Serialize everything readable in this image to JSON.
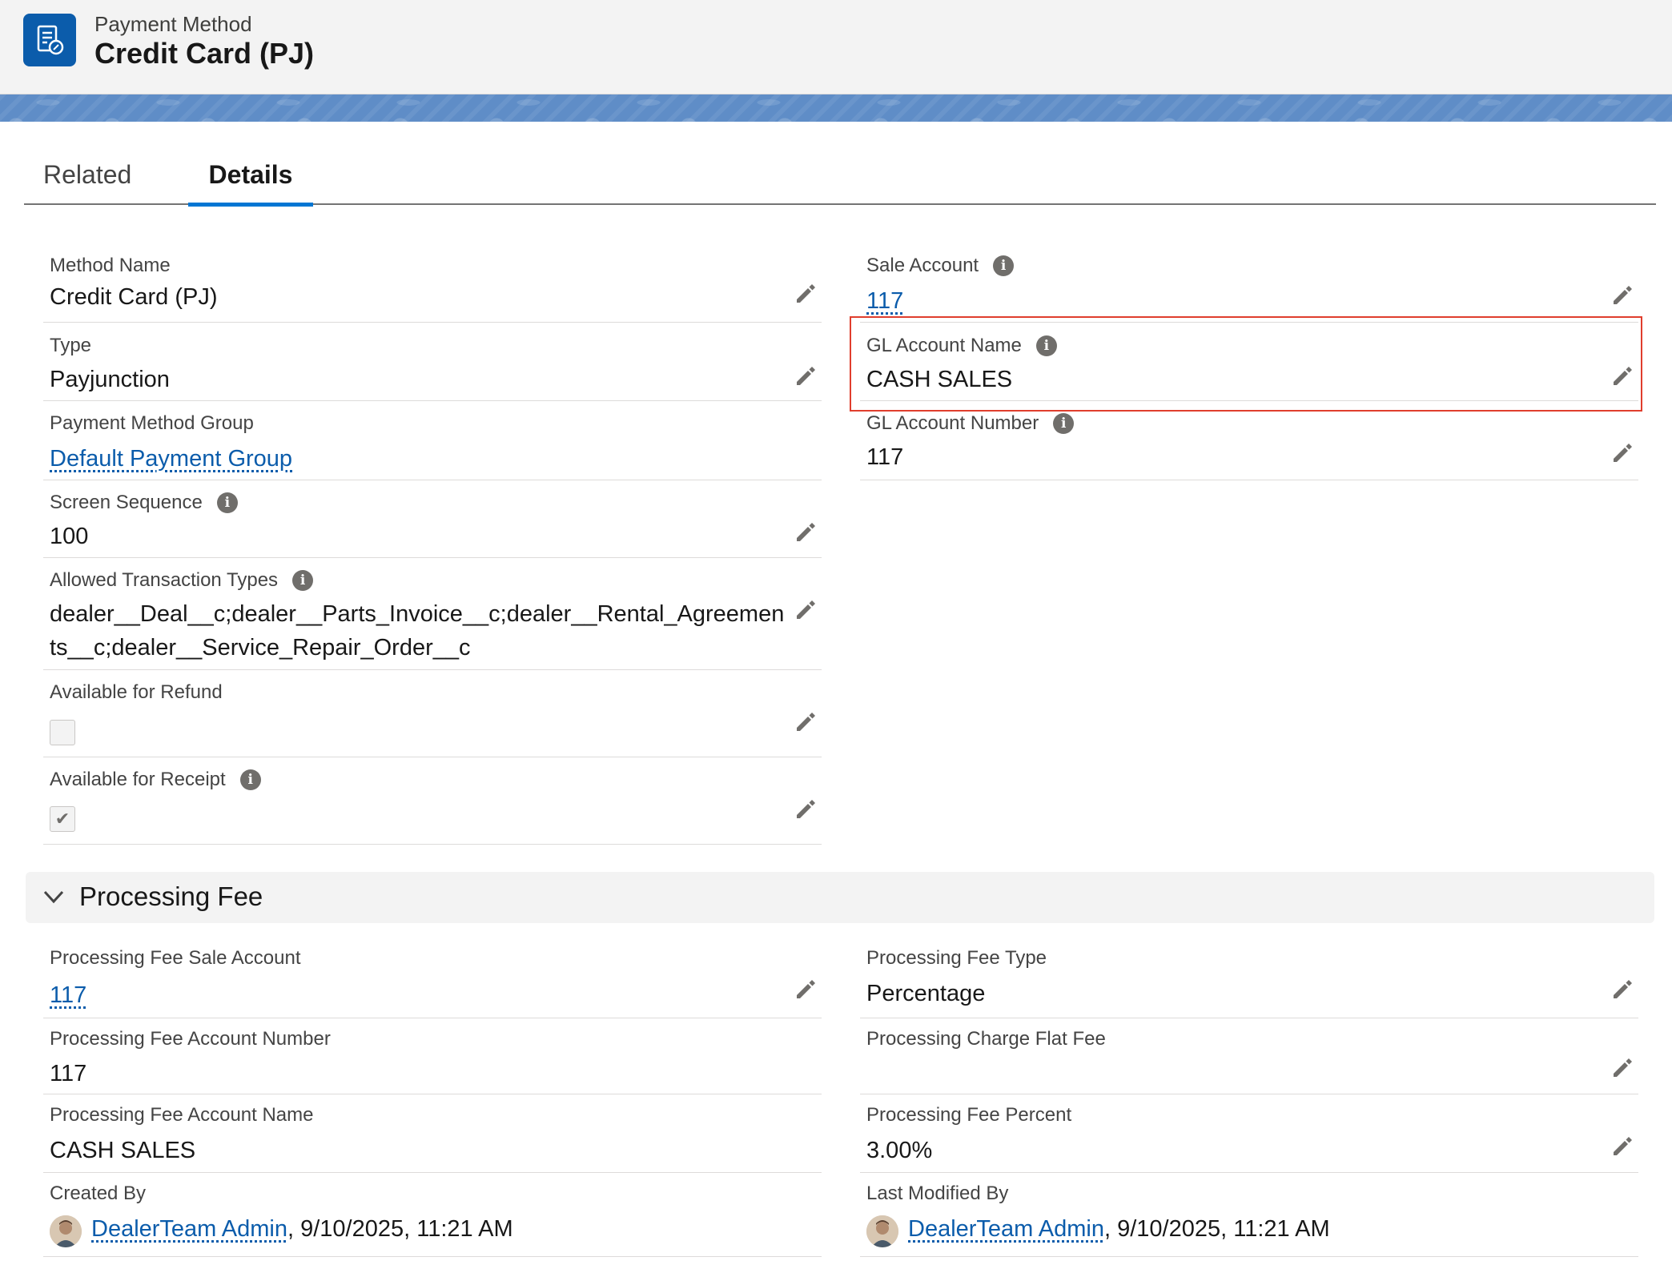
{
  "header": {
    "object_type": "Payment Method",
    "record_title": "Credit Card (PJ)"
  },
  "tabs": [
    {
      "label": "Related",
      "active": false
    },
    {
      "label": "Details",
      "active": true
    }
  ],
  "details": {
    "method_name": {
      "label": "Method Name",
      "value": "Credit Card (PJ)"
    },
    "type": {
      "label": "Type",
      "value": "Payjunction"
    },
    "payment_method_group": {
      "label": "Payment Method Group",
      "value": "Default Payment Group"
    },
    "screen_sequence": {
      "label": "Screen Sequence",
      "value": "100"
    },
    "allowed_transaction_types": {
      "label": "Allowed Transaction Types",
      "value_line1": "dealer__Deal__c;dealer__Parts_Invoice__c;dealer__Rental_Agreemen",
      "value_line2": "ts__c;dealer__Service_Repair_Order__c"
    },
    "available_for_refund": {
      "label": "Available for Refund",
      "checked": false
    },
    "available_for_receipt": {
      "label": "Available for Receipt",
      "checked": true,
      "check_glyph": "✔"
    },
    "sale_account": {
      "label": "Sale Account",
      "value": "117"
    },
    "gl_account_name": {
      "label": "GL Account Name",
      "value": "CASH SALES"
    },
    "gl_account_number": {
      "label": "GL Account Number",
      "value": "117"
    }
  },
  "processing_fee_section": {
    "title": "Processing Fee",
    "expanded": true,
    "sale_account": {
      "label": "Processing Fee Sale Account",
      "value": "117"
    },
    "account_number": {
      "label": "Processing Fee Account Number",
      "value": "117"
    },
    "account_name": {
      "label": "Processing Fee Account Name",
      "value": "CASH SALES"
    },
    "created_by": {
      "label": "Created By",
      "user": "DealerTeam Admin",
      "timestamp": ", 9/10/2025, 11:21 AM"
    },
    "fee_type": {
      "label": "Processing Fee Type",
      "value": "Percentage"
    },
    "flat_fee": {
      "label": "Processing Charge Flat Fee",
      "value": ""
    },
    "fee_percent": {
      "label": "Processing Fee Percent",
      "value": "3.00%"
    },
    "last_modified_by": {
      "label": "Last Modified By",
      "user": "DealerTeam Admin",
      "timestamp": ", 9/10/2025, 11:21 AM"
    }
  },
  "icons": {
    "info": "i",
    "edit": "pencil-icon",
    "chevron": "chevron-down-icon",
    "object": "payment-method-icon"
  },
  "colors": {
    "link": "#0b5cab",
    "header_bg": "#f3f3f3",
    "banner": "#5f8dc7",
    "highlight": "#e03e2d",
    "active_tab": "#0176d3"
  }
}
